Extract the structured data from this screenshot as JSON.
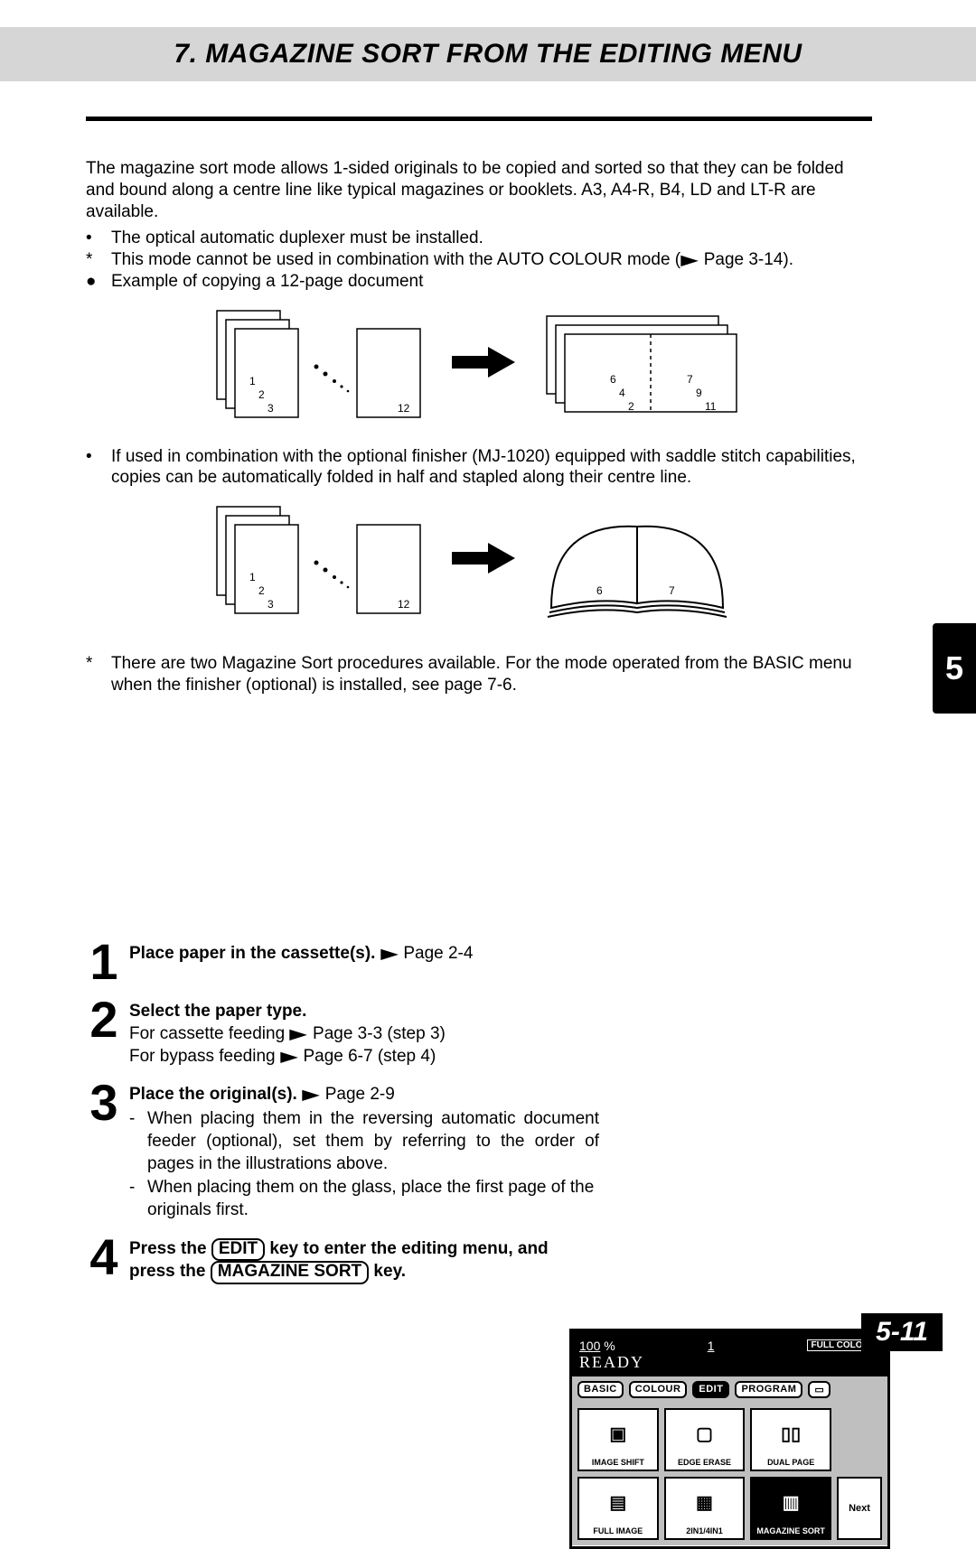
{
  "header": {
    "title": "7. MAGAZINE SORT FROM THE EDITING MENU"
  },
  "intro": {
    "p1": "The magazine sort mode allows 1-sided originals to be copied and sorted so that they can be folded and bound along a centre line like typical magazines or booklets.  A3, A4-R, B4, LD and LT-R are available.",
    "b1": "The optical automatic duplexer must be installed.",
    "b2_prefix": "This mode cannot be used in combination with the AUTO COLOUR mode (",
    "b2_ref": " Page 3-14).",
    "b3": "Example of copying a 12-page document"
  },
  "diagram1": {
    "stack": [
      "1",
      "2",
      "3"
    ],
    "single": "12",
    "spread_left": [
      "6",
      "4",
      "2"
    ],
    "spread_right": [
      "7",
      "9",
      "11"
    ]
  },
  "mid": {
    "b4": "If used in combination with the optional finisher (MJ-1020) equipped with saddle stitch capabilities, copies can be automatically folded in half and stapled along their centre line."
  },
  "diagram2": {
    "stack": [
      "1",
      "2",
      "3"
    ],
    "single": "12",
    "book_left": "6",
    "book_right": "7"
  },
  "note": {
    "text": "There are two Magazine Sort procedures available. For the mode operated from the BASIC menu when the finisher (optional) is installed, see page 7-6."
  },
  "steps": {
    "s1": {
      "num": "1",
      "bold": "Place paper in the cassette(s).",
      "ref": " Page 2-4"
    },
    "s2": {
      "num": "2",
      "bold": "Select the paper type.",
      "l1a": "For cassette feeding ",
      "l1b": " Page 3-3 (step 3)",
      "l2a": "For bypass feeding ",
      "l2b": " Page 6-7 (step 4)"
    },
    "s3": {
      "num": "3",
      "bold": "Place the original(s).",
      "ref": " Page 2-9",
      "d1": "When placing them in the reversing automatic document feeder (optional), set them by referring to the order of pages in the illustrations above.",
      "d2": "When placing them on the glass, place the first page of the originals first."
    },
    "s4": {
      "num": "4",
      "t1": "Press the ",
      "k1": "EDIT",
      "t2": " key to enter the editing menu, and press the ",
      "k2": "MAGAZINE SORT",
      "t3": " key."
    }
  },
  "screen": {
    "zoom": "100",
    "pct": "%",
    "count": "1",
    "mode": "FULL COLOUR",
    "ready": "READY",
    "tabs": {
      "t1": "BASIC",
      "t2": "COLOUR",
      "t3": "EDIT",
      "t4": "PROGRAM"
    },
    "cells": {
      "c1": "IMAGE SHIFT",
      "c2": "EDGE ERASE",
      "c3": "DUAL PAGE",
      "c4": "FULL IMAGE",
      "c5": "2IN1/4IN1",
      "c6": "MAGAZINE SORT"
    },
    "next": "Next"
  },
  "footer": {
    "pagenum": "5-11"
  },
  "chapter": {
    "num": "5"
  }
}
